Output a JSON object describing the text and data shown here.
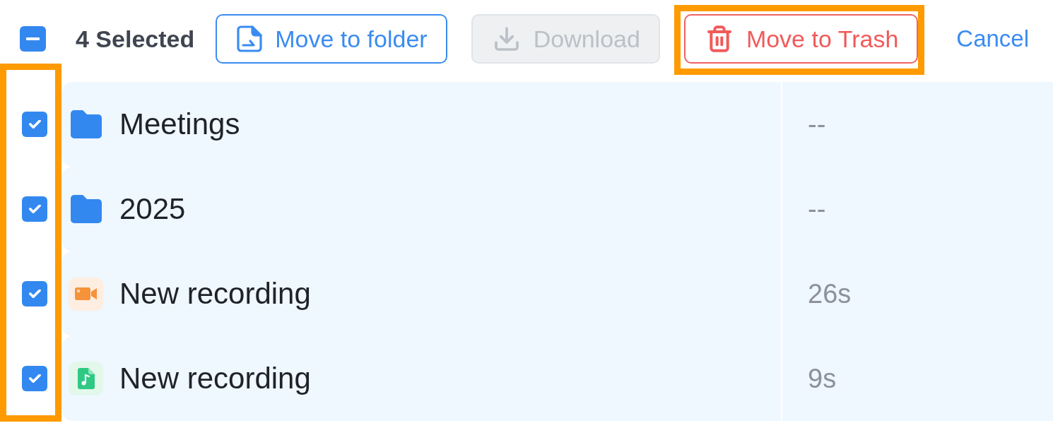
{
  "selection": {
    "indeterminate": true,
    "count_label": "4 Selected"
  },
  "toolbar": {
    "buttons": [
      {
        "kind": "move",
        "label": "Move to folder",
        "disabled": false,
        "highlighted": false
      },
      {
        "kind": "download",
        "label": "Download",
        "disabled": true,
        "highlighted": false
      },
      {
        "kind": "trash",
        "label": "Move to Trash",
        "disabled": false,
        "highlighted": true
      },
      {
        "kind": "link",
        "label": "Cancel",
        "disabled": false,
        "highlighted": false
      }
    ]
  },
  "list": {
    "checkbox_column_highlighted": true,
    "rows": [
      {
        "kind": "folder",
        "name": "Meetings",
        "duration": "--",
        "checked": true
      },
      {
        "kind": "folder",
        "name": "2025",
        "duration": "--",
        "checked": true
      },
      {
        "kind": "video",
        "name": "New recording",
        "duration": "26s",
        "checked": true
      },
      {
        "kind": "audio",
        "name": "New recording",
        "duration": "9s",
        "checked": true
      }
    ]
  }
}
